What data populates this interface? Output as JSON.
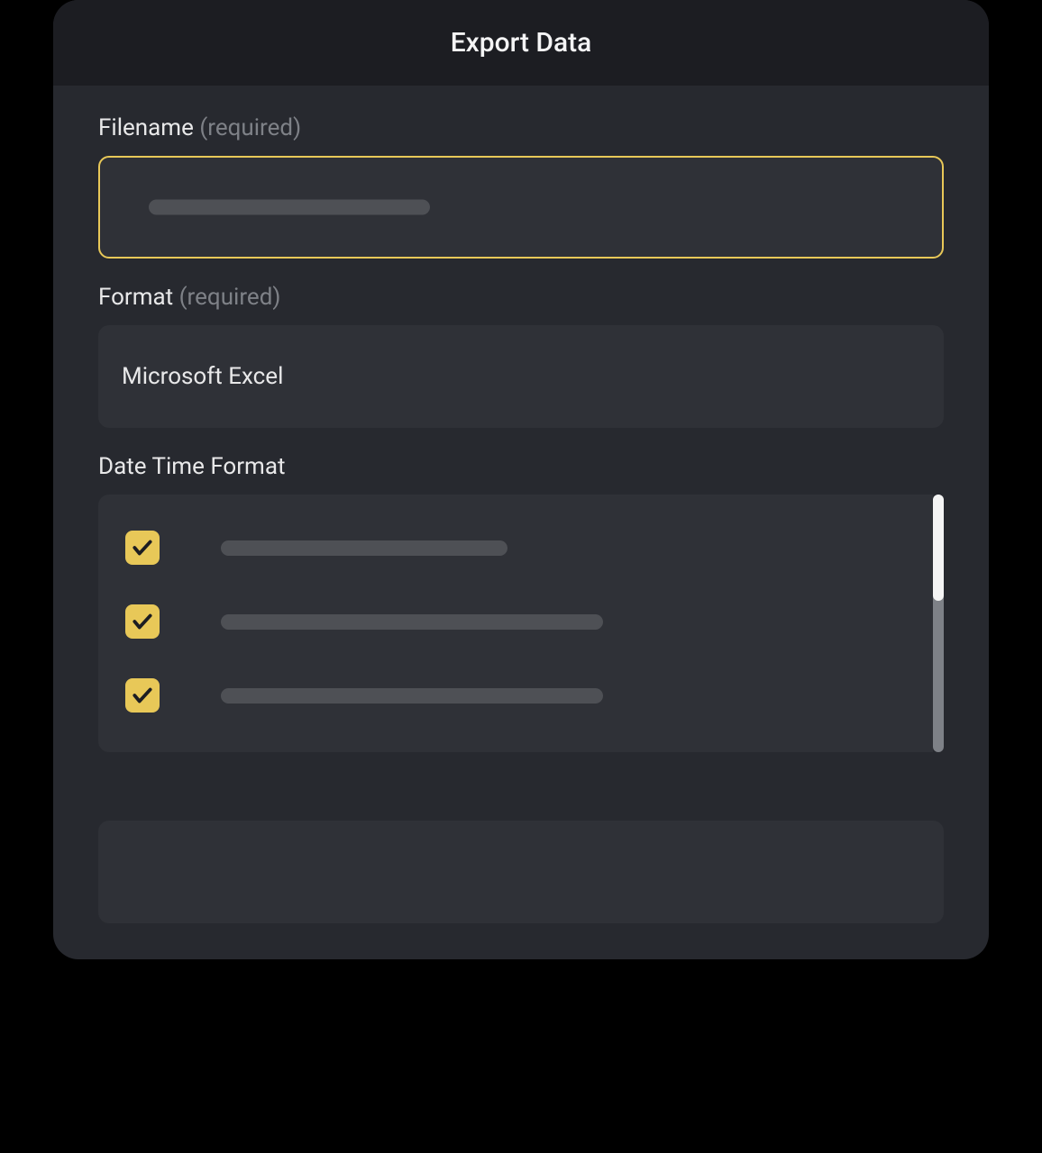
{
  "dialog": {
    "title": "Export Data"
  },
  "filename": {
    "label": "Filename",
    "required_text": "(required)",
    "value": ""
  },
  "format": {
    "label": "Format",
    "required_text": "(required)",
    "selected": "Microsoft Excel"
  },
  "datetime": {
    "label": "Date Time Format",
    "items": [
      {
        "checked": true
      },
      {
        "checked": true
      },
      {
        "checked": true
      }
    ]
  }
}
